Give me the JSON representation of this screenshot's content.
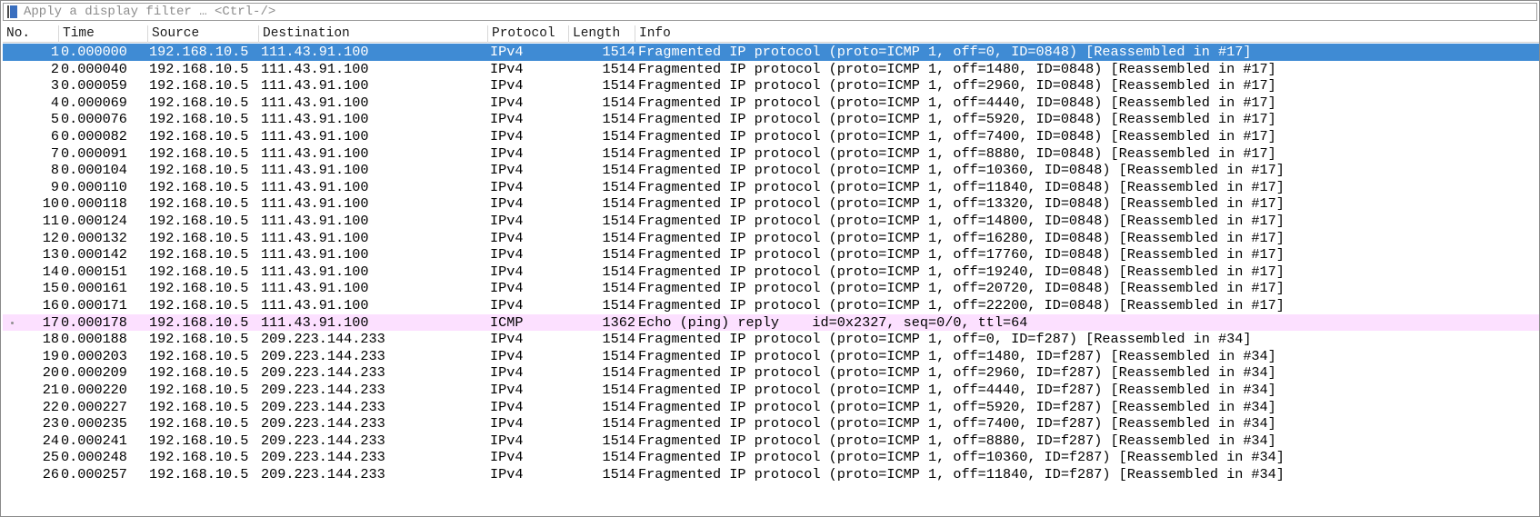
{
  "filter": {
    "placeholder": "Apply a display filter … <Ctrl-/>"
  },
  "icons": {
    "bookmark": "bookmark-icon",
    "related_packet": "related-packet-dot-icon"
  },
  "colors": {
    "selected_row": "#3f8bd4",
    "icmp_row": "#fce0ff"
  },
  "columns": [
    {
      "key": "no",
      "label": "No."
    },
    {
      "key": "time",
      "label": "Time"
    },
    {
      "key": "source",
      "label": "Source"
    },
    {
      "key": "destination",
      "label": "Destination"
    },
    {
      "key": "protocol",
      "label": "Protocol"
    },
    {
      "key": "length",
      "label": "Length"
    },
    {
      "key": "info",
      "label": "Info"
    }
  ],
  "packets": [
    {
      "no": "1",
      "time": "0.000000",
      "source": "192.168.10.5",
      "destination": "111.43.91.100",
      "protocol": "IPv4",
      "length": "1514",
      "info": "Fragmented IP protocol (proto=ICMP 1, off=0, ID=0848) [Reassembled in #17]",
      "state": "selected"
    },
    {
      "no": "2",
      "time": "0.000040",
      "source": "192.168.10.5",
      "destination": "111.43.91.100",
      "protocol": "IPv4",
      "length": "1514",
      "info": "Fragmented IP protocol (proto=ICMP 1, off=1480, ID=0848) [Reassembled in #17]",
      "state": "normal"
    },
    {
      "no": "3",
      "time": "0.000059",
      "source": "192.168.10.5",
      "destination": "111.43.91.100",
      "protocol": "IPv4",
      "length": "1514",
      "info": "Fragmented IP protocol (proto=ICMP 1, off=2960, ID=0848) [Reassembled in #17]",
      "state": "normal"
    },
    {
      "no": "4",
      "time": "0.000069",
      "source": "192.168.10.5",
      "destination": "111.43.91.100",
      "protocol": "IPv4",
      "length": "1514",
      "info": "Fragmented IP protocol (proto=ICMP 1, off=4440, ID=0848) [Reassembled in #17]",
      "state": "normal"
    },
    {
      "no": "5",
      "time": "0.000076",
      "source": "192.168.10.5",
      "destination": "111.43.91.100",
      "protocol": "IPv4",
      "length": "1514",
      "info": "Fragmented IP protocol (proto=ICMP 1, off=5920, ID=0848) [Reassembled in #17]",
      "state": "normal"
    },
    {
      "no": "6",
      "time": "0.000082",
      "source": "192.168.10.5",
      "destination": "111.43.91.100",
      "protocol": "IPv4",
      "length": "1514",
      "info": "Fragmented IP protocol (proto=ICMP 1, off=7400, ID=0848) [Reassembled in #17]",
      "state": "normal"
    },
    {
      "no": "7",
      "time": "0.000091",
      "source": "192.168.10.5",
      "destination": "111.43.91.100",
      "protocol": "IPv4",
      "length": "1514",
      "info": "Fragmented IP protocol (proto=ICMP 1, off=8880, ID=0848) [Reassembled in #17]",
      "state": "normal"
    },
    {
      "no": "8",
      "time": "0.000104",
      "source": "192.168.10.5",
      "destination": "111.43.91.100",
      "protocol": "IPv4",
      "length": "1514",
      "info": "Fragmented IP protocol (proto=ICMP 1, off=10360, ID=0848) [Reassembled in #17]",
      "state": "normal"
    },
    {
      "no": "9",
      "time": "0.000110",
      "source": "192.168.10.5",
      "destination": "111.43.91.100",
      "protocol": "IPv4",
      "length": "1514",
      "info": "Fragmented IP protocol (proto=ICMP 1, off=11840, ID=0848) [Reassembled in #17]",
      "state": "normal"
    },
    {
      "no": "10",
      "time": "0.000118",
      "source": "192.168.10.5",
      "destination": "111.43.91.100",
      "protocol": "IPv4",
      "length": "1514",
      "info": "Fragmented IP protocol (proto=ICMP 1, off=13320, ID=0848) [Reassembled in #17]",
      "state": "normal"
    },
    {
      "no": "11",
      "time": "0.000124",
      "source": "192.168.10.5",
      "destination": "111.43.91.100",
      "protocol": "IPv4",
      "length": "1514",
      "info": "Fragmented IP protocol (proto=ICMP 1, off=14800, ID=0848) [Reassembled in #17]",
      "state": "normal"
    },
    {
      "no": "12",
      "time": "0.000132",
      "source": "192.168.10.5",
      "destination": "111.43.91.100",
      "protocol": "IPv4",
      "length": "1514",
      "info": "Fragmented IP protocol (proto=ICMP 1, off=16280, ID=0848) [Reassembled in #17]",
      "state": "normal"
    },
    {
      "no": "13",
      "time": "0.000142",
      "source": "192.168.10.5",
      "destination": "111.43.91.100",
      "protocol": "IPv4",
      "length": "1514",
      "info": "Fragmented IP protocol (proto=ICMP 1, off=17760, ID=0848) [Reassembled in #17]",
      "state": "normal"
    },
    {
      "no": "14",
      "time": "0.000151",
      "source": "192.168.10.5",
      "destination": "111.43.91.100",
      "protocol": "IPv4",
      "length": "1514",
      "info": "Fragmented IP protocol (proto=ICMP 1, off=19240, ID=0848) [Reassembled in #17]",
      "state": "normal"
    },
    {
      "no": "15",
      "time": "0.000161",
      "source": "192.168.10.5",
      "destination": "111.43.91.100",
      "protocol": "IPv4",
      "length": "1514",
      "info": "Fragmented IP protocol (proto=ICMP 1, off=20720, ID=0848) [Reassembled in #17]",
      "state": "normal"
    },
    {
      "no": "16",
      "time": "0.000171",
      "source": "192.168.10.5",
      "destination": "111.43.91.100",
      "protocol": "IPv4",
      "length": "1514",
      "info": "Fragmented IP protocol (proto=ICMP 1, off=22200, ID=0848) [Reassembled in #17]",
      "state": "normal"
    },
    {
      "no": "17",
      "time": "0.000178",
      "source": "192.168.10.5",
      "destination": "111.43.91.100",
      "protocol": "ICMP",
      "length": "1362",
      "info": "Echo (ping) reply    id=0x2327, seq=0/0, ttl=64",
      "state": "icmp"
    },
    {
      "no": "18",
      "time": "0.000188",
      "source": "192.168.10.5",
      "destination": "209.223.144.233",
      "protocol": "IPv4",
      "length": "1514",
      "info": "Fragmented IP protocol (proto=ICMP 1, off=0, ID=f287) [Reassembled in #34]",
      "state": "normal"
    },
    {
      "no": "19",
      "time": "0.000203",
      "source": "192.168.10.5",
      "destination": "209.223.144.233",
      "protocol": "IPv4",
      "length": "1514",
      "info": "Fragmented IP protocol (proto=ICMP 1, off=1480, ID=f287) [Reassembled in #34]",
      "state": "normal"
    },
    {
      "no": "20",
      "time": "0.000209",
      "source": "192.168.10.5",
      "destination": "209.223.144.233",
      "protocol": "IPv4",
      "length": "1514",
      "info": "Fragmented IP protocol (proto=ICMP 1, off=2960, ID=f287) [Reassembled in #34]",
      "state": "normal"
    },
    {
      "no": "21",
      "time": "0.000220",
      "source": "192.168.10.5",
      "destination": "209.223.144.233",
      "protocol": "IPv4",
      "length": "1514",
      "info": "Fragmented IP protocol (proto=ICMP 1, off=4440, ID=f287) [Reassembled in #34]",
      "state": "normal"
    },
    {
      "no": "22",
      "time": "0.000227",
      "source": "192.168.10.5",
      "destination": "209.223.144.233",
      "protocol": "IPv4",
      "length": "1514",
      "info": "Fragmented IP protocol (proto=ICMP 1, off=5920, ID=f287) [Reassembled in #34]",
      "state": "normal"
    },
    {
      "no": "23",
      "time": "0.000235",
      "source": "192.168.10.5",
      "destination": "209.223.144.233",
      "protocol": "IPv4",
      "length": "1514",
      "info": "Fragmented IP protocol (proto=ICMP 1, off=7400, ID=f287) [Reassembled in #34]",
      "state": "normal"
    },
    {
      "no": "24",
      "time": "0.000241",
      "source": "192.168.10.5",
      "destination": "209.223.144.233",
      "protocol": "IPv4",
      "length": "1514",
      "info": "Fragmented IP protocol (proto=ICMP 1, off=8880, ID=f287) [Reassembled in #34]",
      "state": "normal"
    },
    {
      "no": "25",
      "time": "0.000248",
      "source": "192.168.10.5",
      "destination": "209.223.144.233",
      "protocol": "IPv4",
      "length": "1514",
      "info": "Fragmented IP protocol (proto=ICMP 1, off=10360, ID=f287) [Reassembled in #34]",
      "state": "normal"
    },
    {
      "no": "26",
      "time": "0.000257",
      "source": "192.168.10.5",
      "destination": "209.223.144.233",
      "protocol": "IPv4",
      "length": "1514",
      "info": "Fragmented IP protocol (proto=ICMP 1, off=11840, ID=f287) [Reassembled in #34]",
      "state": "normal"
    }
  ]
}
